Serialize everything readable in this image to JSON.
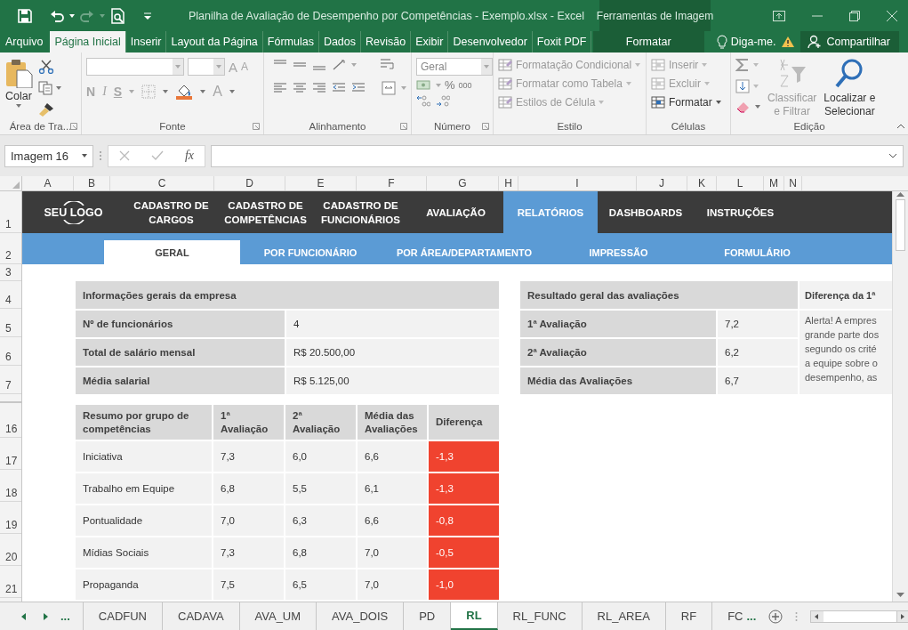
{
  "title_bar": {
    "title": "Planilha de Avaliação de Desempenho por Competências - Exemplo.xlsx - Excel",
    "contextual_title": "Ferramentas de Imagem"
  },
  "ribbon_tabs": [
    {
      "label": "Arquivo",
      "kind": "file",
      "selected": false
    },
    {
      "label": "Página Inicial",
      "kind": "tab",
      "selected": true
    },
    {
      "label": "Inserir",
      "kind": "tab",
      "selected": false
    },
    {
      "label": "Layout da Página",
      "kind": "tab",
      "selected": false
    },
    {
      "label": "Fórmulas",
      "kind": "tab",
      "selected": false
    },
    {
      "label": "Dados",
      "kind": "tab",
      "selected": false
    },
    {
      "label": "Revisão",
      "kind": "tab",
      "selected": false
    },
    {
      "label": "Exibir",
      "kind": "tab",
      "selected": false
    },
    {
      "label": "Desenvolvedor",
      "kind": "tab",
      "selected": false
    },
    {
      "label": "Foxit PDF",
      "kind": "tab",
      "selected": false
    },
    {
      "label": "Formatar",
      "kind": "contextual",
      "selected": false
    }
  ],
  "tell_me": "Diga-me.",
  "share_button": "Compartilhar",
  "ribbon": {
    "clipboard": {
      "label": "Área de Tra...",
      "paste": "Colar"
    },
    "font": {
      "label": "Fonte",
      "disabled": true,
      "bold": "N",
      "italic": "I",
      "underline": "S",
      "grow": "A",
      "shrink": "A",
      "font_color": "A"
    },
    "alignment": {
      "label": "Alinhamento"
    },
    "number": {
      "label": "Número",
      "format": "Geral",
      "percent": "%",
      "thousands": "000"
    },
    "styles": {
      "label": "Estilo",
      "items": [
        {
          "label": "Formatação Condicional",
          "disabled": true
        },
        {
          "label": "Formatar como Tabela",
          "disabled": true
        },
        {
          "label": "Estilos de Célula",
          "disabled": true
        }
      ]
    },
    "cells": {
      "label": "Células",
      "items": [
        {
          "label": "Inserir",
          "disabled": true
        },
        {
          "label": "Excluir",
          "disabled": true
        },
        {
          "label": "Formatar",
          "disabled": false
        }
      ]
    },
    "editing": {
      "label": "Edição",
      "items": [
        {
          "label": "Classificar\ne Filtrar",
          "disabled": true
        },
        {
          "label": "Localizar e\nSelecionar",
          "disabled": false
        }
      ]
    }
  },
  "formula_bar": {
    "name_box": "Imagem 16",
    "function_button": "fx"
  },
  "column_headers": [
    "A",
    "B",
    "C",
    "D",
    "E",
    "F",
    "G",
    "H",
    "I",
    "J",
    "K",
    "L",
    "M",
    "N"
  ],
  "row_numbers": [
    "1",
    "2",
    "3",
    "4",
    "5",
    "6",
    "7",
    "16",
    "17",
    "18",
    "19",
    "20",
    "21"
  ],
  "nav": {
    "logo": "SEU LOGO",
    "items": [
      {
        "label": "CADASTRO DE CARGOS",
        "selected": false
      },
      {
        "label": "CADASTRO DE COMPETÊNCIAS",
        "selected": false
      },
      {
        "label": "CADASTRO DE FUNCIONÁRIOS",
        "selected": false
      },
      {
        "label": "AVALIAÇÃO",
        "selected": false
      },
      {
        "label": "RELATÓRIOS",
        "selected": true
      },
      {
        "label": "DASHBOARDS",
        "selected": false
      },
      {
        "label": "INSTRUÇÕES",
        "selected": false
      }
    ]
  },
  "subnav": [
    {
      "label": "GERAL",
      "selected": true
    },
    {
      "label": "POR FUNCIONÁRIO",
      "selected": false
    },
    {
      "label": "POR ÁREA/DEPARTAMENTO",
      "selected": false
    },
    {
      "label": "IMPRESSÃO",
      "selected": false
    },
    {
      "label": "FORMULÁRIO",
      "selected": false
    }
  ],
  "company_info": {
    "title": "Informações gerais da empresa",
    "rows": [
      {
        "label": "Nº de funcionários",
        "value": "4"
      },
      {
        "label": "Total de salário mensal",
        "value": "R$ 20.500,00"
      },
      {
        "label": "Média salarial",
        "value": "R$ 5.125,00"
      }
    ]
  },
  "summary": {
    "columns": [
      "Resumo por grupo de competências",
      "1ª Avaliação",
      "2ª Avaliação",
      "Média das Avaliações",
      "Diferença"
    ],
    "rows": [
      {
        "group": "Iniciativa",
        "first": "7,3",
        "second": "6,0",
        "average": "6,6",
        "difference": "-1,3"
      },
      {
        "group": "Trabalho em Equipe",
        "first": "6,8",
        "second": "5,5",
        "average": "6,1",
        "difference": "-1,3"
      },
      {
        "group": "Pontualidade",
        "first": "7,0",
        "second": "6,3",
        "average": "6,6",
        "difference": "-0,8"
      },
      {
        "group": "Mídias Sociais",
        "first": "7,3",
        "second": "6,8",
        "average": "7,0",
        "difference": "-0,5"
      },
      {
        "group": "Propaganda",
        "first": "7,5",
        "second": "6,5",
        "average": "7,0",
        "difference": "-1,0"
      }
    ]
  },
  "results": {
    "title": "Resultado geral das avaliações",
    "rows": [
      {
        "label": "1ª Avaliação",
        "value": "7,2"
      },
      {
        "label": "2ª Avaliação",
        "value": "6,2"
      },
      {
        "label": "Média das Avaliações",
        "value": "6,7"
      }
    ]
  },
  "difference_note": {
    "title": "Diferença da 1ª",
    "text": "Alerta! A empres\ngrande parte dos\nsegundo os crité\na equipe sobre o\ndesempenho, as"
  },
  "sheet_tabs": {
    "more_left": "...",
    "more_right": "...",
    "tabs": [
      {
        "label": "CADFUN",
        "selected": false
      },
      {
        "label": "CADAVA",
        "selected": false
      },
      {
        "label": "AVA_UM",
        "selected": false
      },
      {
        "label": "AVA_DOIS",
        "selected": false
      },
      {
        "label": "PD",
        "selected": false
      },
      {
        "label": "RL",
        "selected": true
      },
      {
        "label": "RL_FUNC",
        "selected": false
      },
      {
        "label": "RL_AREA",
        "selected": false
      },
      {
        "label": "RF",
        "selected": false
      },
      {
        "label": "FC",
        "selected": false
      }
    ]
  }
}
